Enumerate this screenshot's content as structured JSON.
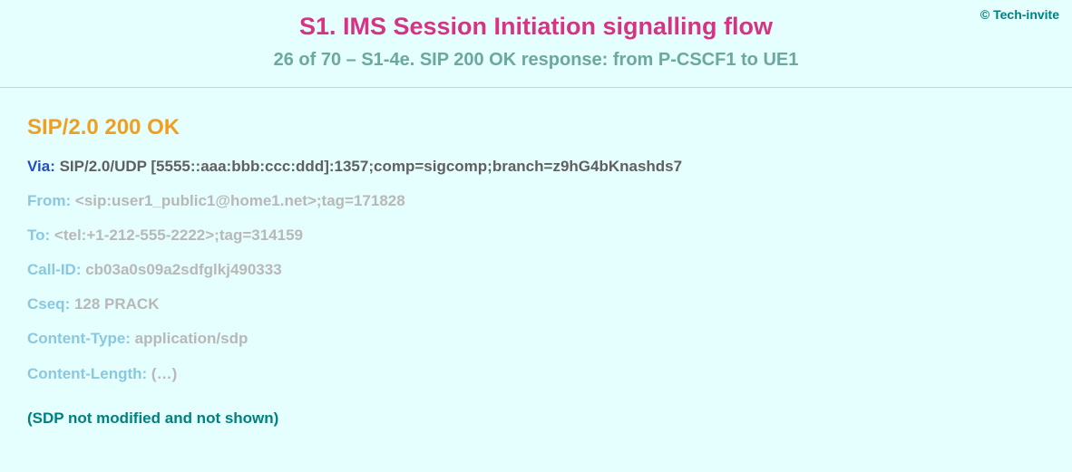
{
  "copyright": "© Tech-invite",
  "header": {
    "title": "S1. IMS Session Initiation signalling flow",
    "subtitle": "26 of 70 – S1-4e. SIP 200 OK response: from P-CSCF1 to UE1"
  },
  "sip": {
    "status_line": "SIP/2.0 200 OK",
    "via_key": "Via:",
    "via_val": " SIP/2.0/UDP [5555::aaa:bbb:ccc:ddd]:1357;comp=sigcomp;branch=z9hG4bKnashds7",
    "from_key": "From:",
    "from_val": " <sip:user1_public1@home1.net>;tag=171828",
    "to_key": "To:",
    "to_val": " <tel:+1-212-555-2222>;tag=314159",
    "callid_key": "Call-ID:",
    "callid_val": " cb03a0s09a2sdfglkj490333",
    "cseq_key": "Cseq:",
    "cseq_val": " 128 PRACK",
    "ctype_key": "Content-Type:",
    "ctype_val": " application/sdp",
    "clen_key": "Content-Length:",
    "clen_val": " (…)"
  },
  "footnote": "(SDP not modified and not shown)"
}
